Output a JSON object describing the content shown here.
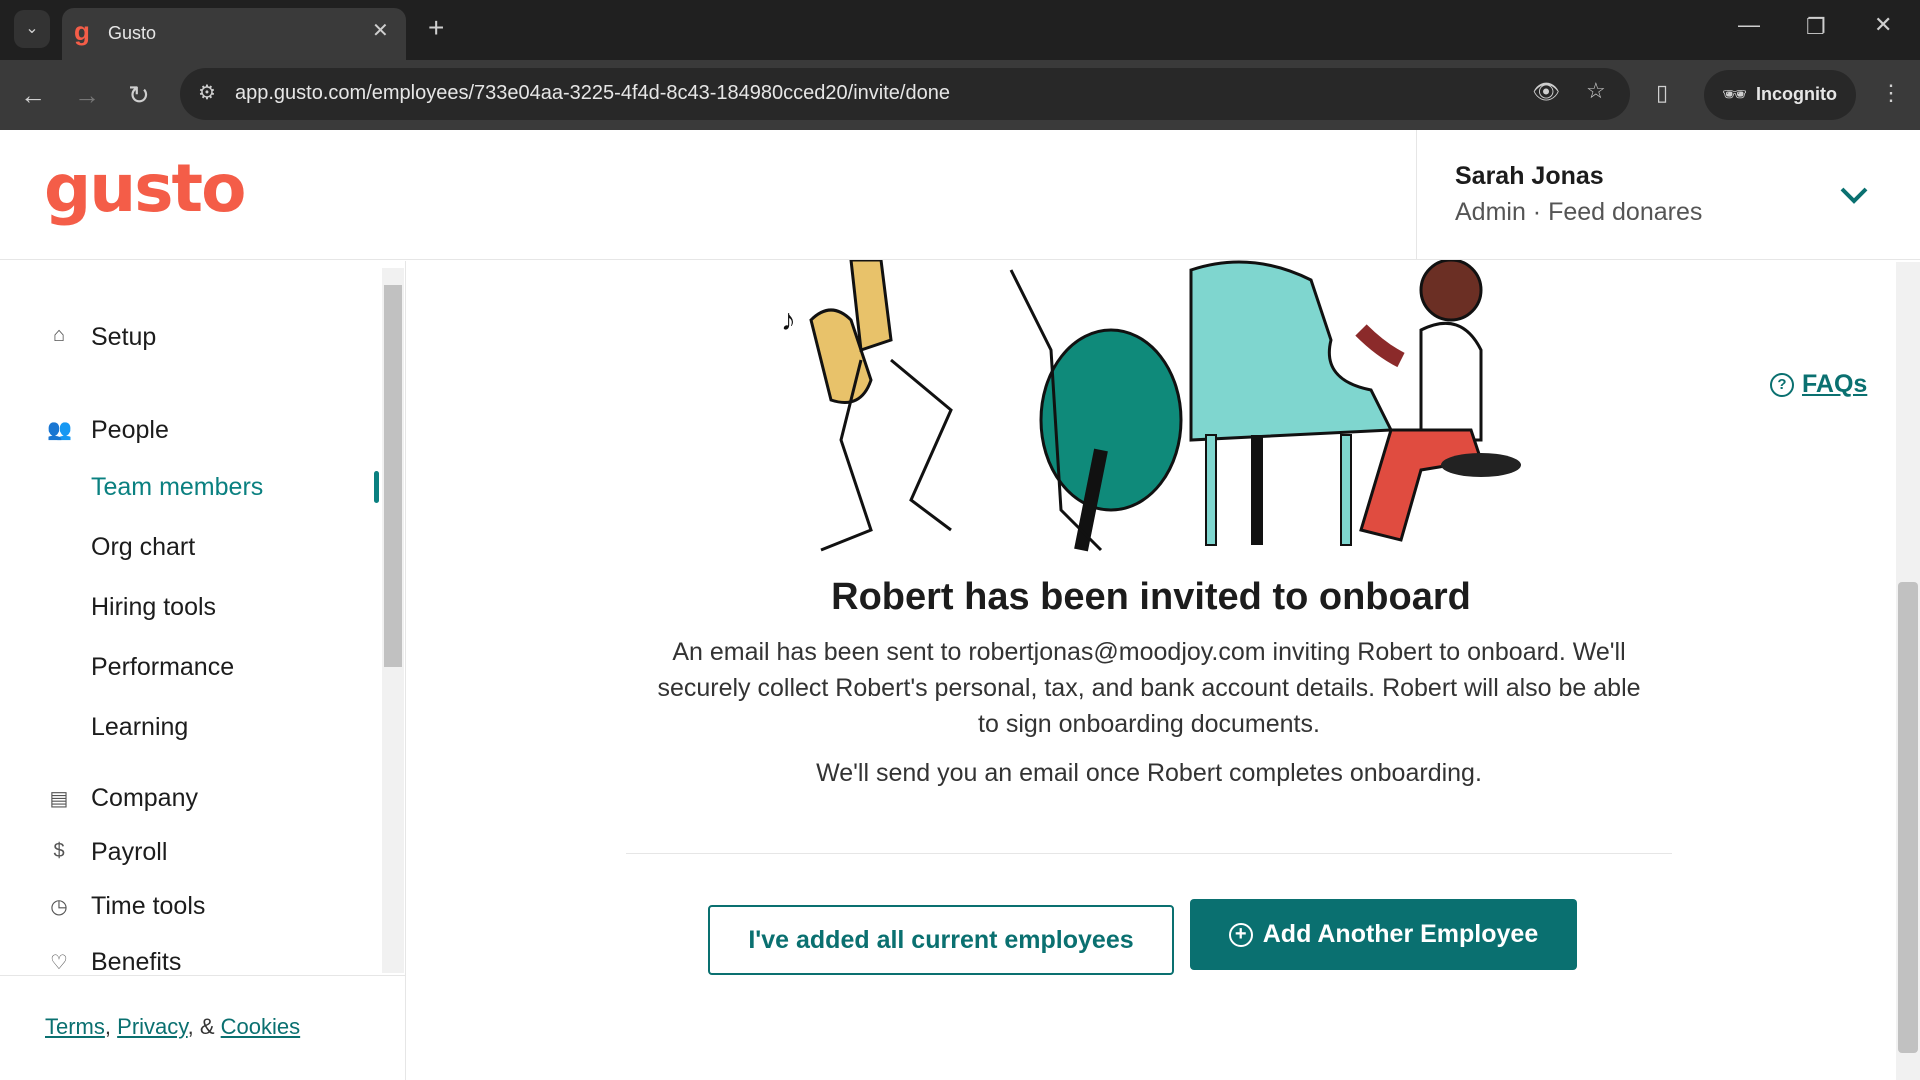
{
  "browser": {
    "tab_title": "Gusto",
    "url": "app.gusto.com/employees/733e04aa-3225-4f4d-8c43-184980cced20/invite/done",
    "incognito_label": "Incognito"
  },
  "header": {
    "logo": "gusto",
    "user_name": "Sarah Jonas",
    "user_role": "Admin · Feed donares"
  },
  "sidebar": {
    "items": [
      {
        "label": "Setup",
        "icon": "home-icon"
      },
      {
        "label": "People",
        "icon": "people-icon"
      },
      {
        "label": "Team members"
      },
      {
        "label": "Org chart"
      },
      {
        "label": "Hiring tools"
      },
      {
        "label": "Performance"
      },
      {
        "label": "Learning"
      },
      {
        "label": "Company",
        "icon": "store-icon"
      },
      {
        "label": "Payroll",
        "icon": "dollar-icon"
      },
      {
        "label": "Time tools",
        "icon": "clock-icon"
      },
      {
        "label": "Benefits",
        "icon": "heart-icon"
      }
    ],
    "footer": {
      "terms": "Terms",
      "sep1": ",",
      "privacy": "Privacy",
      "sep2": ", &",
      "cookies": "Cookies"
    }
  },
  "main": {
    "faqs": "FAQs",
    "heading": "Robert has been invited to onboard",
    "line1": "An email has been sent to robertjonas@moodjoy.com inviting Robert to onboard. We'll",
    "line2": "securely collect Robert's personal, tax, and bank account details. Robert will also be able",
    "line3": "to sign onboarding documents.",
    "note": "We'll send you an email once Robert completes onboarding.",
    "done_button": "I've added all current employees",
    "add_button": "Add Another Employee"
  },
  "colors": {
    "brand": "#f45d48",
    "accent": "#0a7070"
  }
}
